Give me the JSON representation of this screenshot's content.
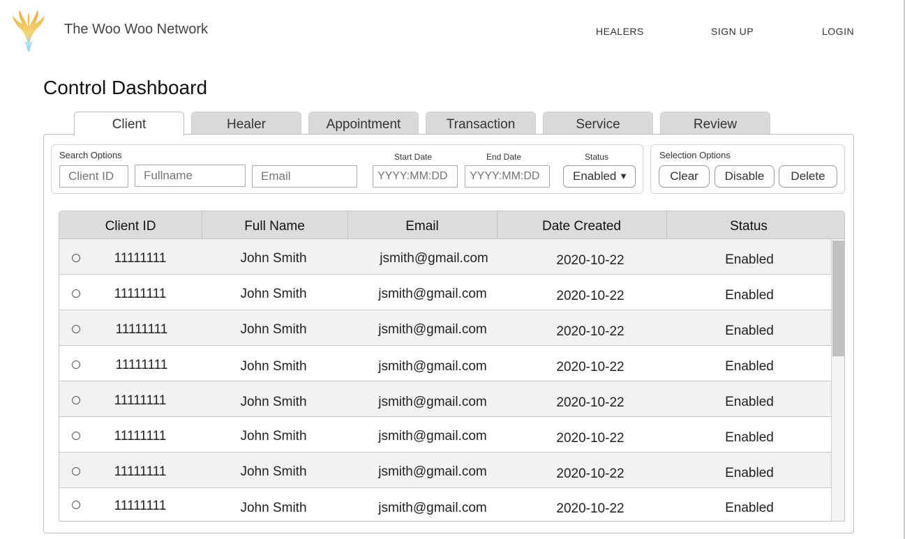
{
  "brand": {
    "name": "The Woo Woo Network"
  },
  "nav": {
    "healers": "HEALERS",
    "signup": "SIGN UP",
    "login": "LOGIN"
  },
  "page_title": "Control Dashboard",
  "tabs": [
    {
      "label": "Client",
      "active": true
    },
    {
      "label": "Healer"
    },
    {
      "label": "Appointment"
    },
    {
      "label": "Transaction"
    },
    {
      "label": "Service"
    },
    {
      "label": "Review"
    }
  ],
  "search": {
    "label": "Search Options",
    "client_id_placeholder": "Client ID",
    "fullname_placeholder": "Fullname",
    "email_placeholder": "Email",
    "start_date_label": "Start Date",
    "start_date_placeholder": "YYYY:MM:DD",
    "end_date_label": "End Date",
    "end_date_placeholder": "YYYY:MM:DD",
    "status_label": "Status",
    "status_value": "Enabled"
  },
  "selection": {
    "label": "Selection Options",
    "clear": "Clear",
    "disable": "Disable",
    "delete": "Delete"
  },
  "table": {
    "columns": [
      "Client ID",
      "Full Name",
      "Email",
      "Date Created",
      "Status"
    ],
    "rows": [
      [
        "11111111",
        "John Smith",
        "jsmith@gmail.com",
        "2020-10-22",
        "Enabled"
      ],
      [
        "11111111",
        "John Smith",
        "jsmith@gmail.com",
        "2020-10-22",
        "Enabled"
      ],
      [
        "11111111",
        "John Smith",
        "jsmith@gmail.com",
        "2020-10-22",
        "Enabled"
      ],
      [
        "11111111",
        "John Smith",
        "jsmith@gmail.com",
        "2020-10-22",
        "Enabled"
      ],
      [
        "11111111",
        "John Smith",
        "jsmith@gmail.com",
        "2020-10-22",
        "Enabled"
      ],
      [
        "11111111",
        "John Smith",
        "jsmith@gmail.com",
        "2020-10-22",
        "Enabled"
      ],
      [
        "11111111",
        "John Smith",
        "jsmith@gmail.com",
        "2020-10-22",
        "Enabled"
      ],
      [
        "11111111",
        "John Smith",
        "jsmith@gmail.com",
        "2020-10-22",
        "Enabled"
      ]
    ]
  },
  "colors": {
    "tab_inactive": "#d9d9d9",
    "header_bg": "#dcdcdc",
    "row_alt": "#f2f2f2"
  },
  "icons": {
    "logo": "phoenix-logo-icon",
    "dropdown": "caret-down-icon",
    "row_select": "radio-icon"
  }
}
